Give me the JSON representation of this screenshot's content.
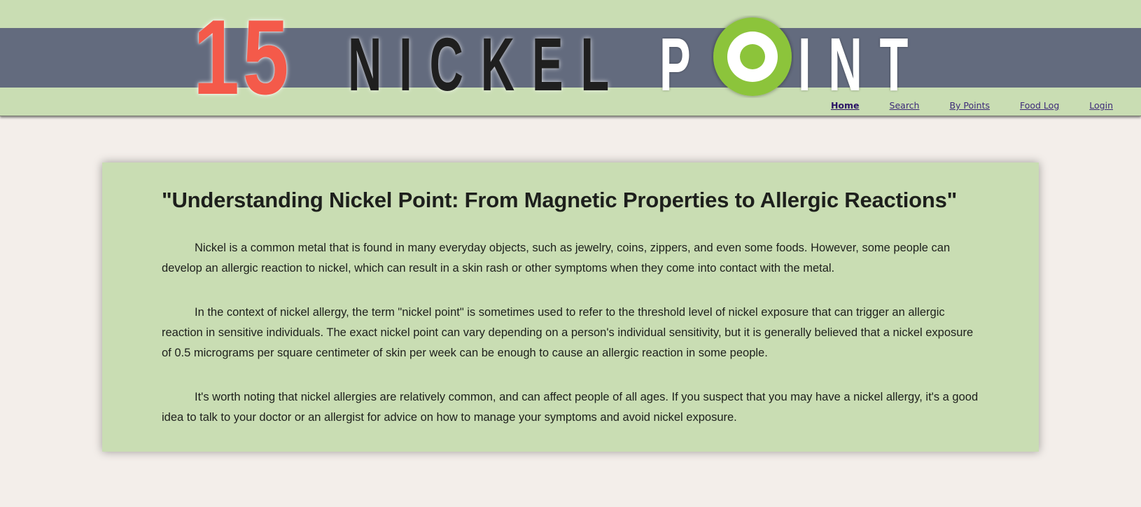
{
  "logo": {
    "number": "15",
    "word1": "NICKEL",
    "word2_first": "P",
    "word2_rest": "INT",
    "colors": {
      "number": "#f45a4a",
      "band": "#636b7e",
      "target_outer": "#8cc43a",
      "target_inner": "#ffffff"
    }
  },
  "nav": {
    "items": [
      {
        "label": "Home",
        "active": true
      },
      {
        "label": "Search"
      },
      {
        "label": "By Points"
      },
      {
        "label": "Food Log"
      },
      {
        "label": "Login"
      }
    ]
  },
  "article": {
    "title": "\"Understanding Nickel Point: From Magnetic Properties to Allergic Reactions\"",
    "paragraphs": [
      "Nickel is a common metal that is found in many everyday objects, such as jewelry, coins, zippers, and even some foods. However, some people can develop an allergic reaction to nickel, which can result in a skin rash or other symptoms when they come into contact with the metal.",
      "In the context of nickel allergy, the term \"nickel point\" is sometimes used to refer to the threshold level of nickel exposure that can trigger an allergic reaction in sensitive individuals. The exact nickel point can vary depending on a person's individual sensitivity, but it is generally believed that a nickel exposure of 0.5 micrograms per square centimeter of skin per week can be enough to cause an allergic reaction in some people.",
      "It's worth noting that nickel allergies are relatively common, and can affect people of all ages. If you suspect that you may have a nickel allergy, it's a good idea to talk to your doctor or an allergist for advice on how to manage your symptoms and avoid nickel exposure."
    ]
  },
  "theme": {
    "page_background": "#f3eeea",
    "header_background": "#c9ddb3",
    "card_background": "#c9ddb3",
    "link_color": "#3d2a78"
  }
}
